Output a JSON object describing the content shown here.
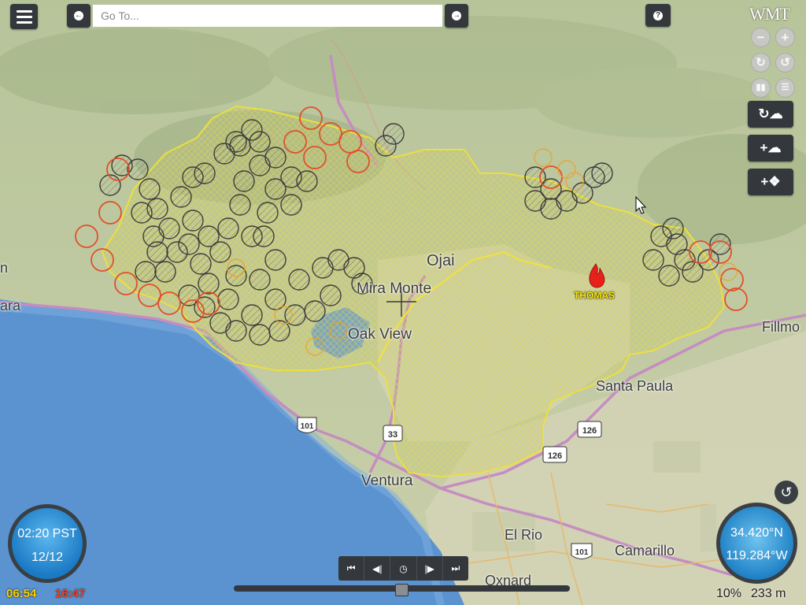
{
  "toolbar": {
    "goto_placeholder": "Go To...",
    "logo_text": "WMT"
  },
  "map": {
    "labels": {
      "ojai": "Ojai",
      "mira_monte": "Mira Monte",
      "oak_view": "Oak View",
      "santa_paula": "Santa Paula",
      "ventura": "Ventura",
      "el_rio": "El Rio",
      "camarillo": "Camarillo",
      "oxnard": "Oxnard",
      "fillmore": "Fillmo",
      "left_edge_n": "n",
      "left_edge_ara": "ara"
    },
    "route_shields": {
      "us101_a": "101",
      "us101_b": "101",
      "ca33": "33",
      "ca126_a": "126",
      "ca126_b": "126"
    },
    "fire_name": "THOMAS",
    "colors": {
      "fire_perimeter": "#f2e23a",
      "hotspot_old": "#3d3d3d",
      "hotspot_recent": "#e0502a",
      "hotspot_new": "#f0a020",
      "highway": "#c58dc1",
      "ocean": "#5b93d0",
      "land": "#c7cfa6"
    }
  },
  "clock": {
    "time": "02:20 PST",
    "date": "12/12",
    "sunrise": "06:54",
    "sunset": "16:47"
  },
  "position": {
    "lat": "34.420°N",
    "lon": "119.284°W"
  },
  "status": {
    "opacity": "10%",
    "scale": "233 m"
  },
  "icons": {
    "menu": "hamburger-icon",
    "back": "arrow-left-icon",
    "forward": "arrow-right-icon",
    "help": "question-icon",
    "zoom_out": "minus-icon",
    "zoom_in": "plus-icon",
    "rotate_cw": "rotate-cw-icon",
    "rotate_ccw": "rotate-ccw-icon",
    "chart": "bar-chart-icon",
    "stack": "layer-stack-icon",
    "fire": "fire-icon"
  }
}
